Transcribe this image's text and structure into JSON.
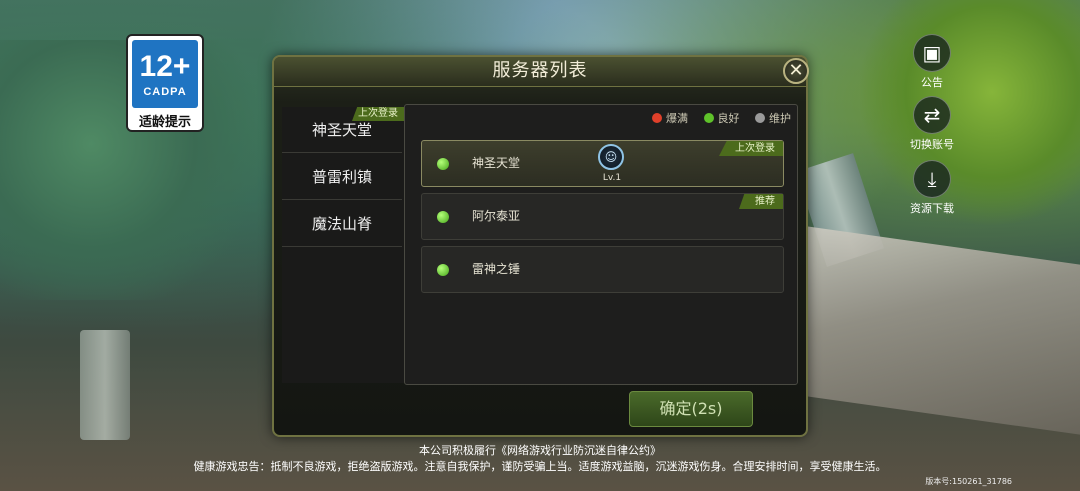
{
  "age_rating": {
    "number": "12+",
    "org": "CADPA",
    "tip": "适龄提示"
  },
  "side_buttons": [
    {
      "label": "公告",
      "icon": "notice-icon"
    },
    {
      "label": "切换账号",
      "icon": "switch-account-icon"
    },
    {
      "label": "资源下载",
      "icon": "download-icon"
    }
  ],
  "dialog": {
    "title": "服务器列表",
    "close": "✕",
    "zones": [
      {
        "label": "神圣天堂",
        "badge": "上次登录"
      },
      {
        "label": "普雷利镇"
      },
      {
        "label": "魔法山脊"
      }
    ],
    "legend": [
      {
        "label": "爆满",
        "color": "#e0402a"
      },
      {
        "label": "良好",
        "color": "#5fc22a"
      },
      {
        "label": "维护",
        "color": "#9a9a9a"
      }
    ],
    "servers": [
      {
        "name": "神圣天堂",
        "tag": "上次登录",
        "level": "Lv.1",
        "selected": true
      },
      {
        "name": "阿尔泰亚",
        "tag": "推荐"
      },
      {
        "name": "雷神之锤"
      }
    ],
    "confirm": "确定(2s)"
  },
  "footer": {
    "line1": "本公司积极履行《网络游戏行业防沉迷自律公约》",
    "line2": "健康游戏忠告：抵制不良游戏，拒绝盗版游戏。注意自我保护，谨防受骗上当。适度游戏益脑，沉迷游戏伤身。合理安排时间，享受健康生活。",
    "version": "版本号:150261_31786"
  }
}
